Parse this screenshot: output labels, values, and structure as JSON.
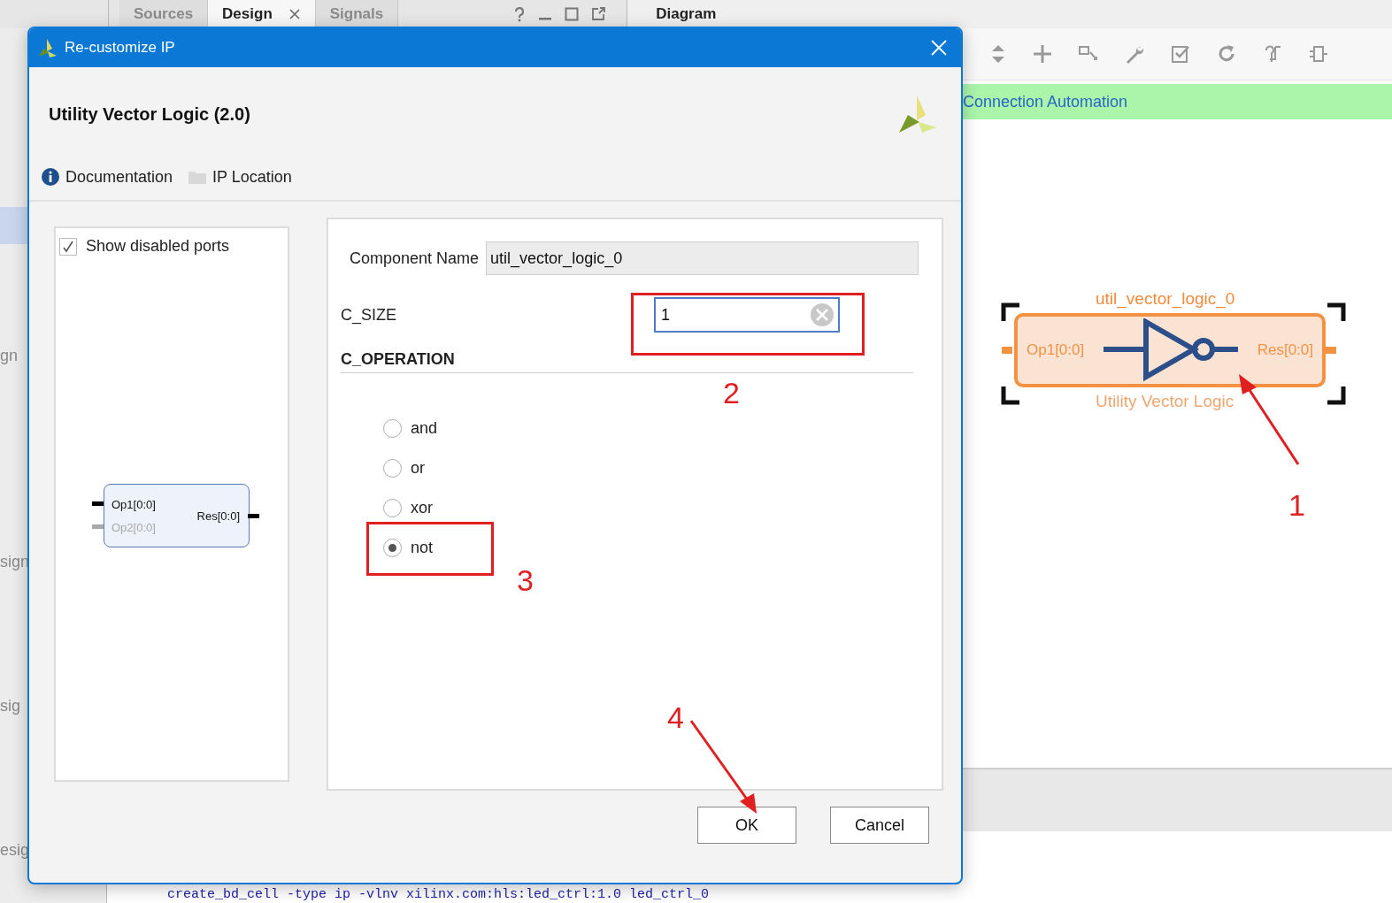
{
  "ide": {
    "tabs": [
      {
        "label": "Sources",
        "selected": false,
        "closable": false
      },
      {
        "label": "Design",
        "selected": true,
        "closable": true
      },
      {
        "label": "Signals",
        "selected": false,
        "closable": false
      }
    ],
    "side_fragments": [
      "gn",
      "sign",
      "sig",
      "esig"
    ],
    "console_line": "create_bd_cell -type ip -vlnv xilinx.com:hls:led_ctrl:1.0 led_ctrl_0"
  },
  "diagram": {
    "title": "Diagram",
    "banner": "Connection Automation",
    "block": {
      "name": "util_vector_logic_0",
      "input": "Op1[0:0]",
      "output": "Res[0:0]",
      "type": "Utility Vector Logic"
    }
  },
  "dialog": {
    "title": "Re-customize IP",
    "ip_name": "Utility Vector Logic (2.0)",
    "links": [
      "Documentation",
      "IP Location"
    ],
    "show_disabled_ports": {
      "label": "Show disabled ports",
      "checked": true
    },
    "preview": {
      "ports_in": [
        {
          "label": "Op1[0:0]",
          "disabled": false
        },
        {
          "label": "Op2[0:0]",
          "disabled": true
        }
      ],
      "port_out": "Res[0:0]"
    },
    "component_name": {
      "label": "Component Name",
      "value": "util_vector_logic_0"
    },
    "c_size": {
      "label": "C_SIZE",
      "value": "1"
    },
    "c_operation": {
      "label": "C_OPERATION",
      "options": [
        {
          "label": "and",
          "selected": false
        },
        {
          "label": "or",
          "selected": false
        },
        {
          "label": "xor",
          "selected": false
        },
        {
          "label": "not",
          "selected": true
        }
      ]
    },
    "buttons": [
      "OK",
      "Cancel"
    ]
  },
  "annotations": [
    "1",
    "2",
    "3",
    "4"
  ]
}
